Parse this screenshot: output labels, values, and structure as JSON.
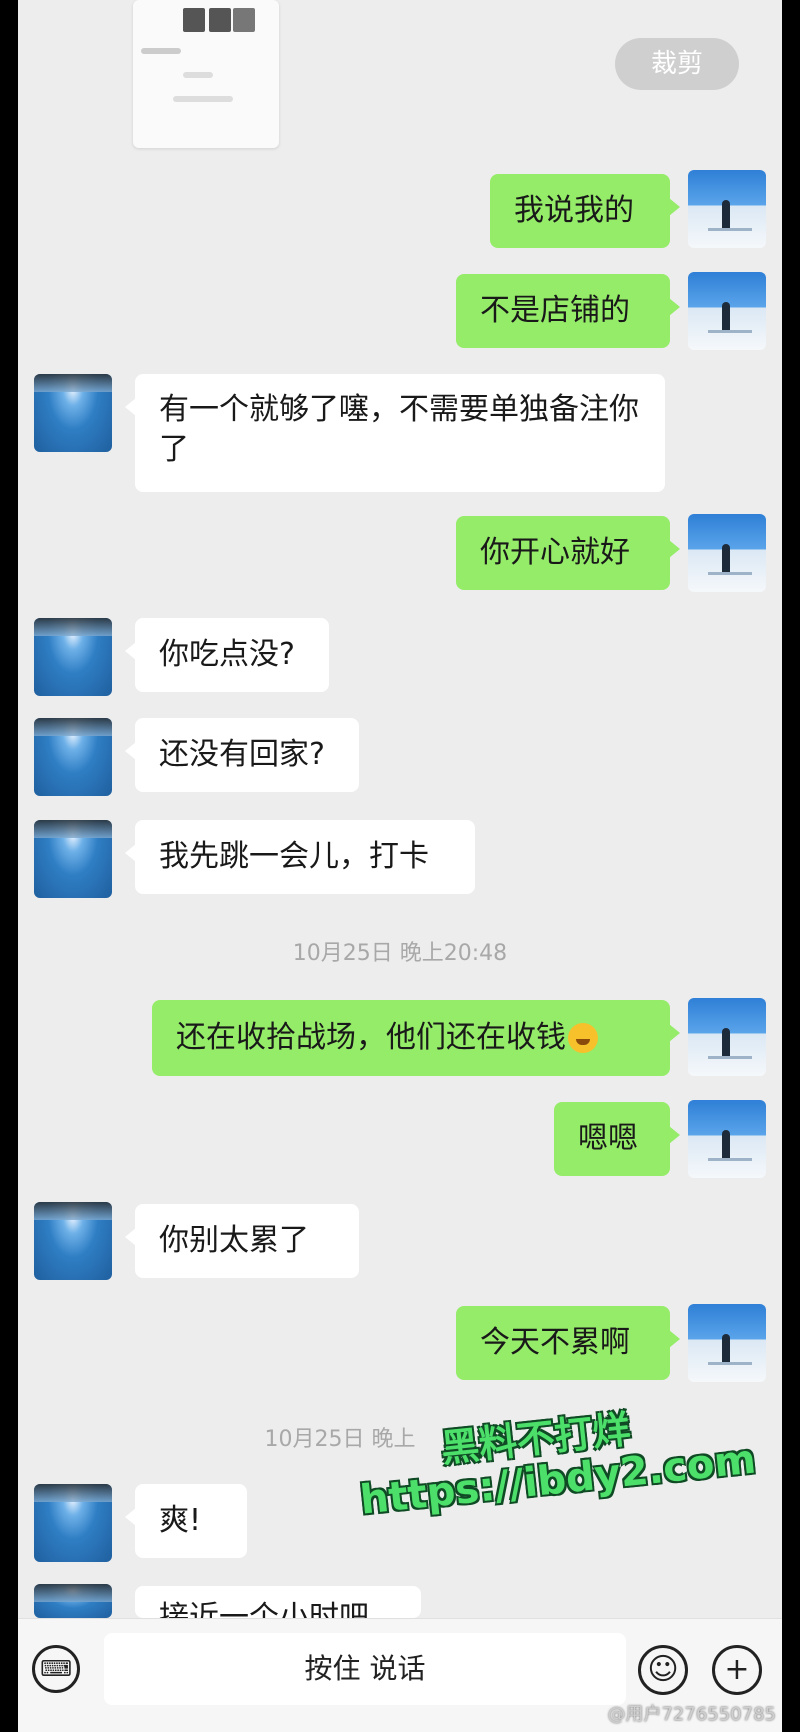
{
  "header": {
    "crop_label": "裁剪"
  },
  "messages": [
    {
      "side": "out",
      "text": "我说我的"
    },
    {
      "side": "out",
      "text": "不是店铺的"
    },
    {
      "side": "in",
      "text": "有一个就够了噻，不需要单独备注你了"
    },
    {
      "side": "out",
      "text": "你开心就好"
    },
    {
      "side": "in",
      "text": "你吃点没?"
    },
    {
      "side": "in",
      "text": "还没有回家?"
    },
    {
      "side": "in",
      "text": "我先跳一会儿，打卡"
    },
    {
      "side": "out",
      "text": "还在收拾战场，他们还在收钱"
    },
    {
      "side": "out",
      "text": "嗯嗯"
    },
    {
      "side": "in",
      "text": "你别太累了"
    },
    {
      "side": "out",
      "text": "今天不累啊"
    },
    {
      "side": "in",
      "text": "爽!"
    },
    {
      "side": "in",
      "text": "接近一个小时吧"
    }
  ],
  "timestamps": [
    "10月25日 晚上20:48",
    "10月25日 晚上"
  ],
  "watermark": {
    "line1": "黑料不打烊",
    "line2": "https://ibdy2.com"
  },
  "input_bar": {
    "voice_label": "按住 说话",
    "keyboard_icon": "keyboard-icon",
    "emoji_icon": "emoji-icon",
    "plus_icon": "plus-icon"
  },
  "footer": {
    "weibo_handle": "@用户7276550785"
  }
}
